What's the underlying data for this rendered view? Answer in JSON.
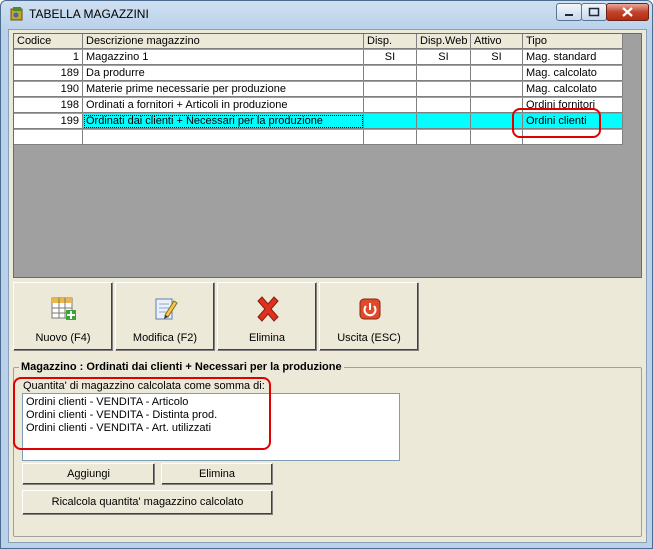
{
  "window": {
    "title": "TABELLA MAGAZZINI",
    "icon": "app-icon"
  },
  "grid": {
    "columns": [
      "Codice",
      "Descrizione magazzino",
      "Disp.",
      "Disp.Web",
      "Attivo",
      "Tipo"
    ],
    "rows": [
      {
        "codice": "1",
        "descrizione": "Magazzino 1",
        "disp": "SI",
        "disp_web": "SI",
        "attivo": "SI",
        "tipo": "Mag. standard"
      },
      {
        "codice": "189",
        "descrizione": "Da produrre",
        "disp": "",
        "disp_web": "",
        "attivo": "",
        "tipo": "Mag. calcolato"
      },
      {
        "codice": "190",
        "descrizione": "Materie prime necessarie per produzione",
        "disp": "",
        "disp_web": "",
        "attivo": "",
        "tipo": "Mag. calcolato"
      },
      {
        "codice": "198",
        "descrizione": "Ordinati a fornitori + Articoli in produzione",
        "disp": "",
        "disp_web": "",
        "attivo": "",
        "tipo": "Ordini fornitori"
      },
      {
        "codice": "199",
        "descrizione": "Ordinati dai clienti + Necessari per la produzione",
        "disp": "",
        "disp_web": "",
        "attivo": "",
        "tipo": "Ordini clienti"
      }
    ],
    "selected_row": 4,
    "selection_color": "#00ffff"
  },
  "toolbar": {
    "nuovo_label": "Nuovo (F4)",
    "modifica_label": "Modifica (F2)",
    "elimina_label": "Elimina",
    "uscita_label": "Uscita (ESC)"
  },
  "detail": {
    "title": "Magazzino : Ordinati dai clienti + Necessari per la produzione",
    "list_label": "Quantita' di magazzino calcolata come somma di:",
    "items": [
      "Ordini clienti - VENDITA - Articolo",
      "Ordini clienti - VENDITA - Distinta prod.",
      "Ordini clienti - VENDITA - Art. utilizzati"
    ],
    "aggiungi_label": "Aggiungi",
    "elimina_label": "Elimina",
    "ricalcola_label": "Ricalcola quantita' magazzino calcolato"
  },
  "colors": {
    "highlight": "#e00000",
    "grid_background": "#a0a0a0"
  }
}
